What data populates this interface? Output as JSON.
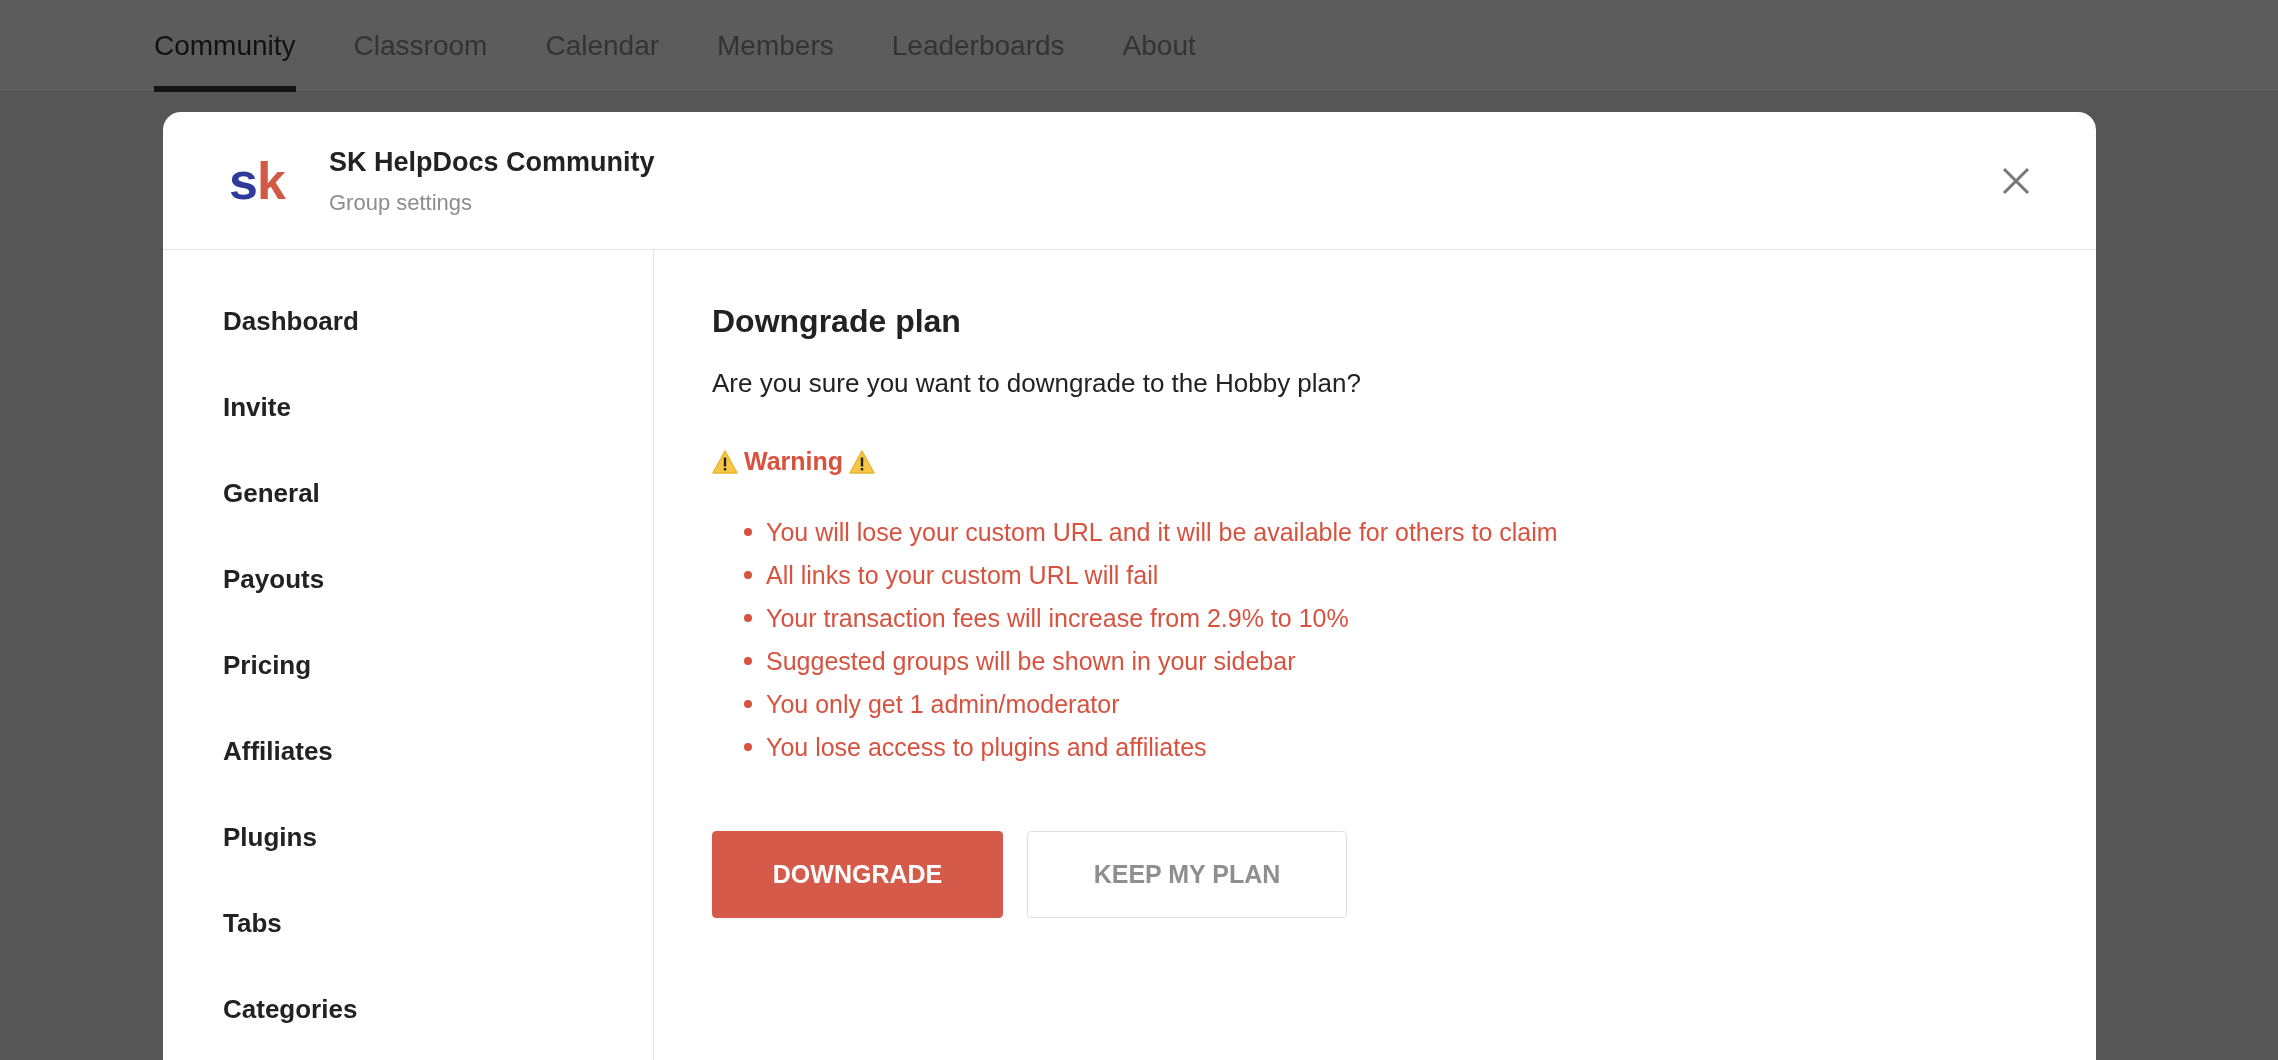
{
  "nav_tabs": [
    {
      "label": "Community",
      "selected": true
    },
    {
      "label": "Classroom",
      "selected": false
    },
    {
      "label": "Calendar",
      "selected": false
    },
    {
      "label": "Members",
      "selected": false
    },
    {
      "label": "Leaderboards",
      "selected": false
    },
    {
      "label": "About",
      "selected": false
    }
  ],
  "modal": {
    "logo": {
      "left": "s",
      "right": "k"
    },
    "title": "SK HelpDocs Community",
    "subtitle": "Group settings",
    "sidebar": {
      "items": [
        {
          "label": "Dashboard"
        },
        {
          "label": "Invite"
        },
        {
          "label": "General"
        },
        {
          "label": "Payouts"
        },
        {
          "label": "Pricing"
        },
        {
          "label": "Affiliates"
        },
        {
          "label": "Plugins"
        },
        {
          "label": "Tabs"
        },
        {
          "label": "Categories"
        }
      ]
    },
    "content": {
      "heading": "Downgrade plan",
      "question": "Are you sure you want to downgrade to the Hobby plan?",
      "warning": "Warning",
      "bullets": [
        "You will lose your custom URL and it will be available for others to claim",
        "All links to your custom URL will fail",
        "Your transaction fees will increase from 2.9% to 10%",
        "Suggested groups will be shown in your sidebar",
        "You only get 1 admin/moderator",
        "You lose access to plugins and affiliates"
      ],
      "buttons": [
        {
          "label": "DOWNGRADE",
          "kind": "danger"
        },
        {
          "label": "KEEP MY PLAN",
          "kind": "outline"
        }
      ]
    }
  }
}
